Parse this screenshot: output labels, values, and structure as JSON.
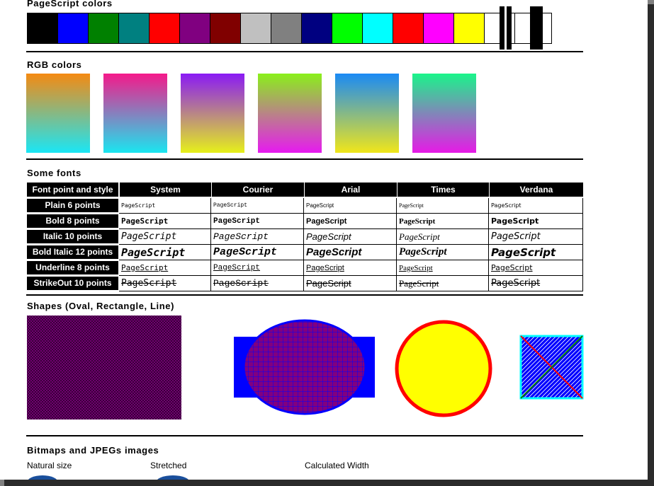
{
  "sections": {
    "pagescript_colors": "PageScript colors",
    "rgb_colors": "RGB colors",
    "some_fonts": "Some fonts",
    "shapes": "Shapes (Oval, Rectangle, Line)",
    "bitmaps": "Bitmaps and JPEGs images"
  },
  "palette": [
    "#000000",
    "#0000ff",
    "#008000",
    "#008080",
    "#ff0000",
    "#800080",
    "#800000",
    "#c0c0c0",
    "#808080",
    "#000080",
    "#00ff00",
    "#00ffff",
    "#ff0000",
    "#ff00ff",
    "#ffff00",
    "#ffffff",
    "#ffffff"
  ],
  "gradients": [
    {
      "top": "#f58a12",
      "bottom": "#1ae6f5"
    },
    {
      "top": "#f5198a",
      "bottom": "#1ae6f0"
    },
    {
      "top": "#8a1af5",
      "bottom": "#e6f01a"
    },
    {
      "top": "#8af01a",
      "bottom": "#e61af0"
    },
    {
      "top": "#1a8af5",
      "bottom": "#f0e61a"
    },
    {
      "top": "#1af58a",
      "bottom": "#e61ae6"
    }
  ],
  "font_table": {
    "corner": "Font point and style",
    "columns": [
      "System",
      "Courier",
      "Arial",
      "Times",
      "Verdana"
    ],
    "rows": [
      "Plain 6 points",
      "Bold 8 points",
      "Italic 10 points",
      "Bold Italic 12 points",
      "Underline 8 points",
      "StrikeOut 10 points"
    ],
    "sample": "PageScript"
  },
  "shape_colors": {
    "hatch_square": "#800080",
    "blue_rect": "#0000ff",
    "oval_fill": "#800080",
    "circle_fill": "#ffff00",
    "circle_stroke": "#ff0000",
    "square_fill": "#0000ff",
    "square_stroke": "#00ffff"
  },
  "image_captions": [
    "Natural size",
    "Stretched",
    "Calculated Width"
  ]
}
